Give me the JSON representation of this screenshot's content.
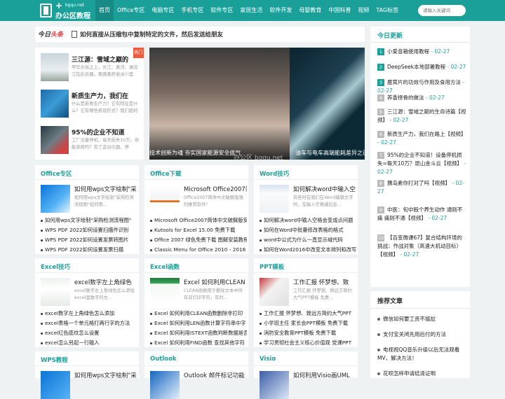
{
  "brand": {
    "domain": "bgqu.net",
    "name": "办公区教程"
  },
  "nav": [
    "首页",
    "Office专区",
    "电脑专区",
    "手机专区",
    "软件专区",
    "家居生活",
    "软件开发",
    "母婴教育",
    "中国科普",
    "视频",
    "TAG标签"
  ],
  "search": {
    "placeholder": "请输入关键词"
  },
  "headline": {
    "logo_a": "今日",
    "logo_b": "头条",
    "text": "如何直接从压缩包中复制特定的文件，然后发送给朋友"
  },
  "hot_badge": "热门",
  "left_news": [
    {
      "title": "三江源：雪域之巅的",
      "desc": "甲华水瑶之上，长江、黄河、澜沧江在此另履。奥路画舒诶冰川里"
    },
    {
      "title": "新质生产力，我们在",
      "desc": "什么是新质生产力？它有特征是什么？它有哪些表现形式？我们如何"
    },
    {
      "title": "95%的企业不知道",
      "desc": "工厂设备停机，每天损失10万，你能承担吗？有了这台仪器，停"
    }
  ],
  "slider": {
    "caption1": "技术创新为魂 夯实国家能源安全底气",
    "caption2": "油车与电车高端能耗差异之谜",
    "watermark": "办公区 bgqu.net"
  },
  "today": {
    "title": "今日更新",
    "items": [
      {
        "n": "1",
        "t": "小爱音箱使用教程",
        "d": " - 02-27"
      },
      {
        "n": "2",
        "t": "DeepSeek本地部署教程",
        "d": " - 02-27"
      },
      {
        "n": "3",
        "t": "鹿茸片的功效与作用及食用方法",
        "d": " - 02-27"
      },
      {
        "n": "4",
        "t": "荞香择骨的做法",
        "d": " - 02-27"
      },
      {
        "n": "5",
        "t": "三江源：雪域之巅的生命诗篇【视频】",
        "d": " - 02-27"
      },
      {
        "n": "6",
        "t": "新质生产力，我们在路上【视频】",
        "d": " - 02-27"
      },
      {
        "n": "7",
        "t": "95%的企业不知道！设备停机损失=每天10万？昆山金斗云【视频】",
        "d": " - 02-27"
      },
      {
        "n": "8",
        "t": "胰岛素你打对了吗【视频】",
        "d": " - 02-27"
      },
      {
        "n": "9",
        "t": "中医：旬中殴个养生动作 通则不痛 痛则不通【视频】",
        "d": " - 02-27"
      },
      {
        "n": "10",
        "t": "【百变微课67】复合结构环境的挑战：作战对象（高速大机动目标）【视频】",
        "d": " - 02-27"
      }
    ]
  },
  "recommend": {
    "title": "推荐文章",
    "items": [
      "微信如何要工资不尴尬",
      "支付宝关闭先用后付的方法",
      "电视视QQ音乐升级以后无法观看MV，解决方法！",
      "花呗怎样申请结清证明"
    ]
  },
  "sections": [
    {
      "title": "Office专区",
      "pic_title": "如何用wps文字绘制\"采",
      "pic_desc": "如何用wps文字绘制\"采购检测流程图\"如何用...",
      "items": [
        "如何用wps文字绘制\"采购检测流程图\"",
        "WPS PDF 2022如何设置扫描件识别",
        "WPS PDF 2022如何设置发票转图片",
        "WPS PDF 2022如何设置发票扫描"
      ]
    },
    {
      "title": "Office下载",
      "pic_title": "Microsoft Office2007简",
      "pic_desc": "Office2007简体中文破解版强烈推荐软件！",
      "items": [
        "Microsoft Office2007简体中文破解版安",
        "Kutools for Excel 15.00 免费下载",
        "Office 2007 绿色免费下载 图解安装教程",
        "Classic Menu for Office 2010 - 2016 免"
      ]
    },
    {
      "title": "Word技巧",
      "pic_title": "如何解决word中输入空",
      "pic_desc": "有些时在我们在Word编辑文字时，在输入空格键后会...",
      "items": [
        "如何解决word中输入空格会变成点问题",
        "如何在Word中批量修改表格的格式",
        "word中公式为什么一直显示域代码",
        "如何在Word2016中改变文本排列和改写"
      ]
    },
    {
      "title": "Excel技巧",
      "pic_title": "excel数字左上角绿色",
      "pic_desc": "excel数字左上角绿色怎么添加excel里数字的左...",
      "items": [
        "excel数字左上角绿色怎么添加",
        "excel表格一个单元格打两行字的方法",
        "excel红色底纹怎么设置",
        "excel怎么另起一行输入"
      ]
    },
    {
      "title": "Excel函数",
      "pic_title": "Excel 如何利用CLEAN",
      "pic_desc": "CLEAN函数用于删除文本中所有非打印字符，有时...",
      "items": [
        "Excel 如何利用CLEAN函数删除非打印",
        "Excel 如何利用LEN函数计算字符串中字",
        "Excel 如何利用ISTEXT函数判断数据是否",
        "Excel 如何利用FIND函数 查找其他字符"
      ]
    },
    {
      "title": "PPT模板",
      "pic_title": "工作汇报 怀梦想、致",
      "pic_desc": "工作汇报 怀梦想、致远方简约大气PPT模板 免费...",
      "items": [
        "工作汇报 怀梦想、致远方简约大气PPT",
        "小学班主任 家长会PPT模板 免费下载",
        "消防安全教育PPT模板 免费下载",
        "学习贯彻社会主义核心价值观 党课PPT"
      ]
    },
    {
      "title": "WPS教程",
      "pic_title": "如何用wps文字绘制\"采"
    },
    {
      "title": "Outlook",
      "pic_title": "Outlook 邮件标记功能"
    },
    {
      "title": "Visio",
      "pic_title": "如何利用Visio画UML"
    }
  ],
  "colors": {
    "brand": "#1b9f99",
    "accent": "#f05a3c"
  }
}
